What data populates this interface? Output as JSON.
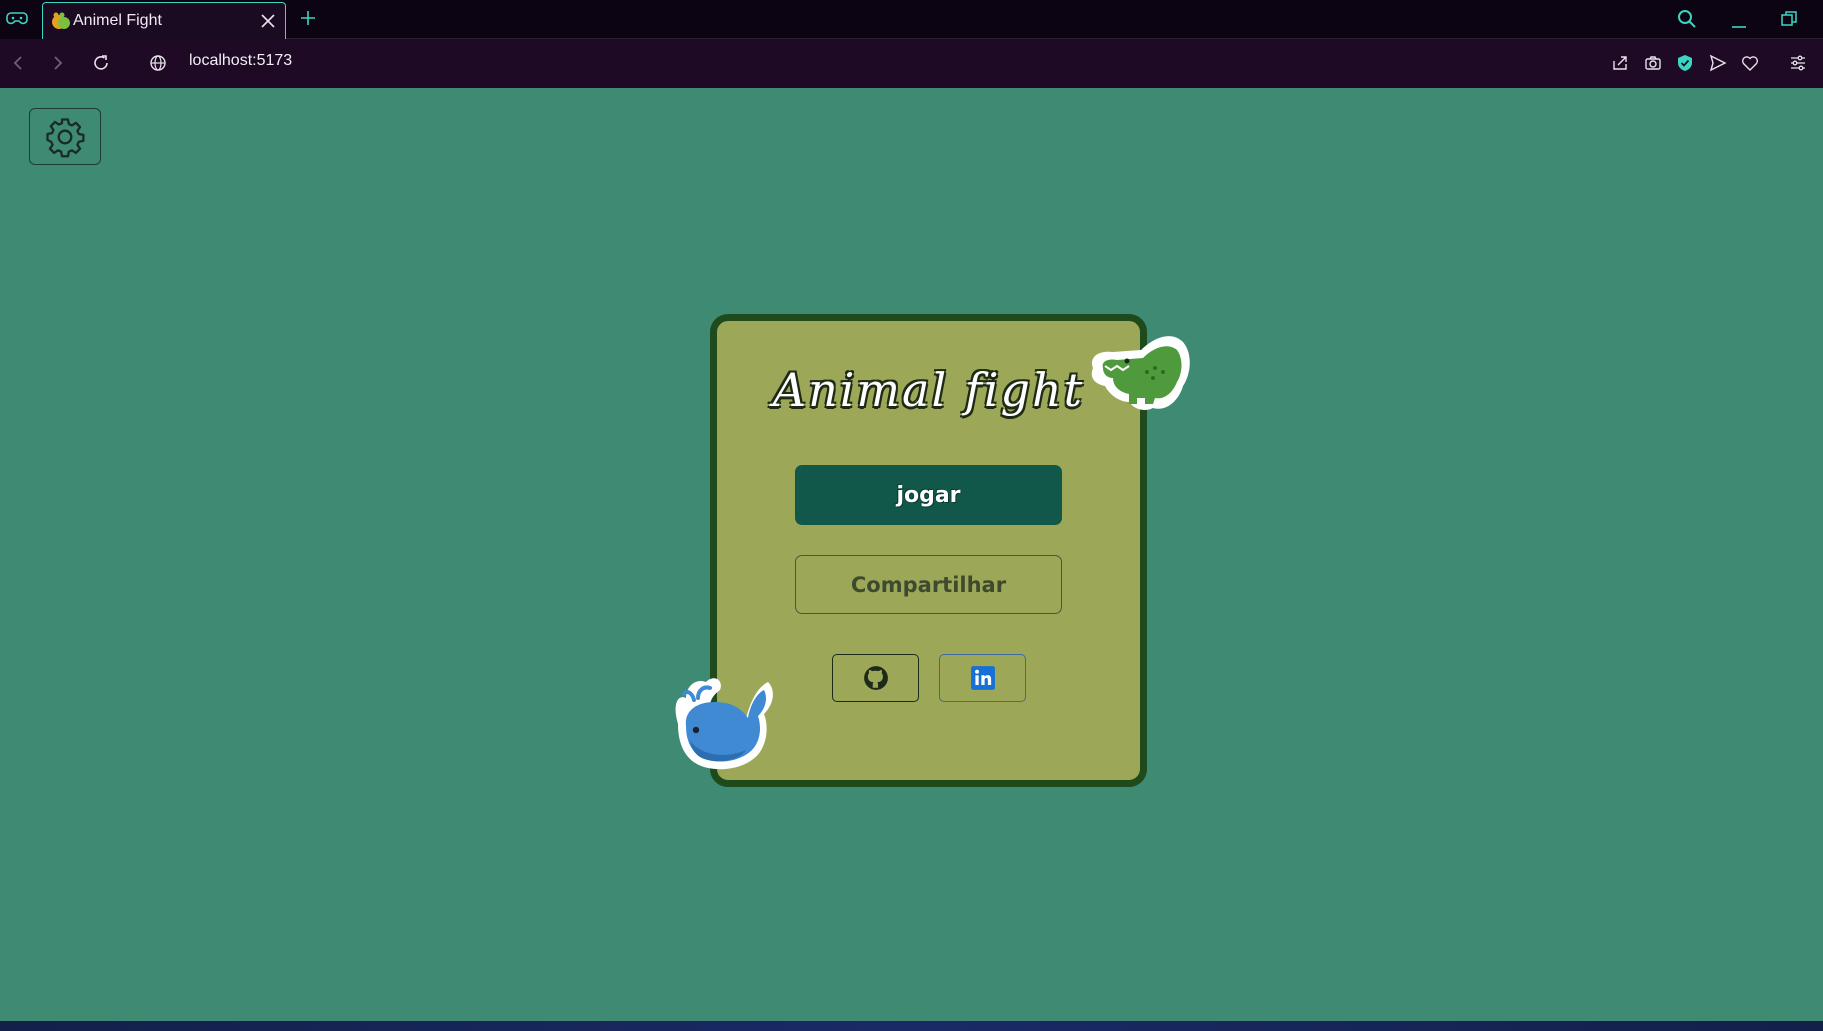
{
  "browser": {
    "tab_title": "Animel Fight",
    "url": "localhost:5173"
  },
  "page": {
    "title": "Animal fight",
    "play_label": "jogar",
    "share_label": "Compartilhar",
    "icons": {
      "settings": "gear-icon",
      "github": "github-icon",
      "linkedin": "linkedin-icon",
      "sticker_top": "crocodile-sticker",
      "sticker_bottom": "whale-sticker"
    }
  },
  "colors": {
    "page_bg": "#3e8a73",
    "card_bg": "#9ca858",
    "card_border": "#1e4a1c",
    "play_bg": "#12584a",
    "accent": "#3ad6c2"
  }
}
